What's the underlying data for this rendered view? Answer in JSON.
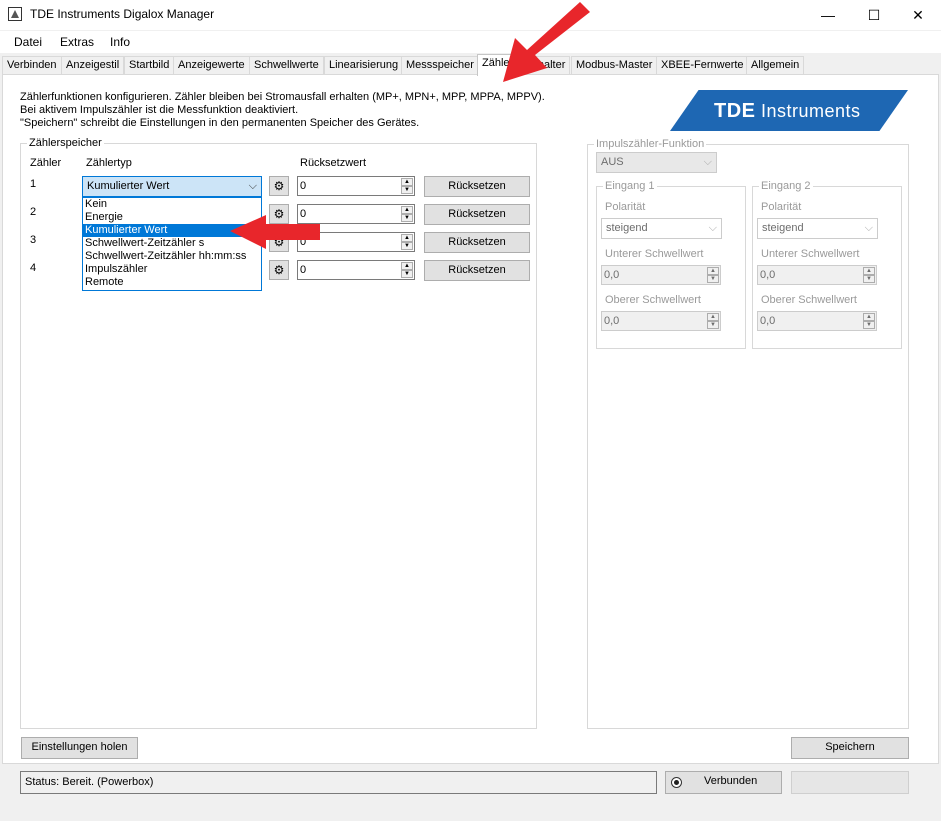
{
  "window": {
    "title": "TDE Instruments Digalox Manager",
    "minimize": "—",
    "maximize": "☐",
    "close": "✕"
  },
  "menu": [
    "Datei",
    "Extras",
    "Info"
  ],
  "tabs": [
    "Verbinden",
    "Anzeigestil",
    "Startbild",
    "Anzeigewerte",
    "Schwellwerte",
    "Linearisierung",
    "Messspeicher",
    "Zähler",
    "Schalter",
    "Modbus-Master",
    "XBEE-Fernwerte",
    "Allgemein"
  ],
  "active_tab": "Zähler",
  "info_lines": [
    "Zählerfunktionen konfigurieren. Zähler bleiben bei Stromausfall erhalten (MP+, MPN+, MPP, MPPA, MPPV).",
    "Bei aktivem Impulszähler ist die Messfunktion deaktiviert.",
    "\"Speichern\" schreibt die Einstellungen in den permanenten Speicher des Gerätes."
  ],
  "logo": {
    "bold": "TDE",
    "normal": " Instruments",
    "color": "#1e67b3"
  },
  "counter_group": {
    "label": "Zählerspeicher",
    "col_counter": "Zähler",
    "col_type": "Zählertyp",
    "col_reset_value": "Rücksetzwert",
    "rows": [
      {
        "num": "1",
        "type": "Kumulierter Wert",
        "value": "0",
        "button": "Rücksetzen"
      },
      {
        "num": "2",
        "type": "",
        "value": "0",
        "button": "Rücksetzen"
      },
      {
        "num": "3",
        "type": "",
        "value": "0",
        "button": "Rücksetzen"
      },
      {
        "num": "4",
        "type": "",
        "value": "0",
        "button": "Rücksetzen"
      }
    ],
    "dropdown_options": [
      "Kein",
      "Energie",
      "Kumulierter Wert",
      "Schwellwert-Zeitzähler s",
      "Schwellwert-Zeitzähler hh:mm:ss",
      "Impulszähler",
      "Remote"
    ],
    "selected_option": "Kumulierter Wert"
  },
  "pulse_group": {
    "label": "Impulszähler-Funktion",
    "function_value": "AUS",
    "inputs": [
      {
        "label": "Eingang 1",
        "polarity_label": "Polarität",
        "polarity": "steigend",
        "lower_label": "Unterer Schwellwert",
        "lower": "0,0",
        "upper_label": "Oberer Schwellwert",
        "upper": "0,0"
      },
      {
        "label": "Eingang 2",
        "polarity_label": "Polarität",
        "polarity": "steigend",
        "lower_label": "Unterer Schwellwert",
        "lower": "0,0",
        "upper_label": "Oberer Schwellwert",
        "upper": "0,0"
      }
    ]
  },
  "buttons": {
    "load": "Einstellungen holen",
    "save": "Speichern"
  },
  "status": {
    "text": "Status: Bereit. (Powerbox)",
    "connected": "Verbunden"
  },
  "colors": {
    "accent": "#0078d7",
    "annotation_arrow": "#e8262b"
  }
}
